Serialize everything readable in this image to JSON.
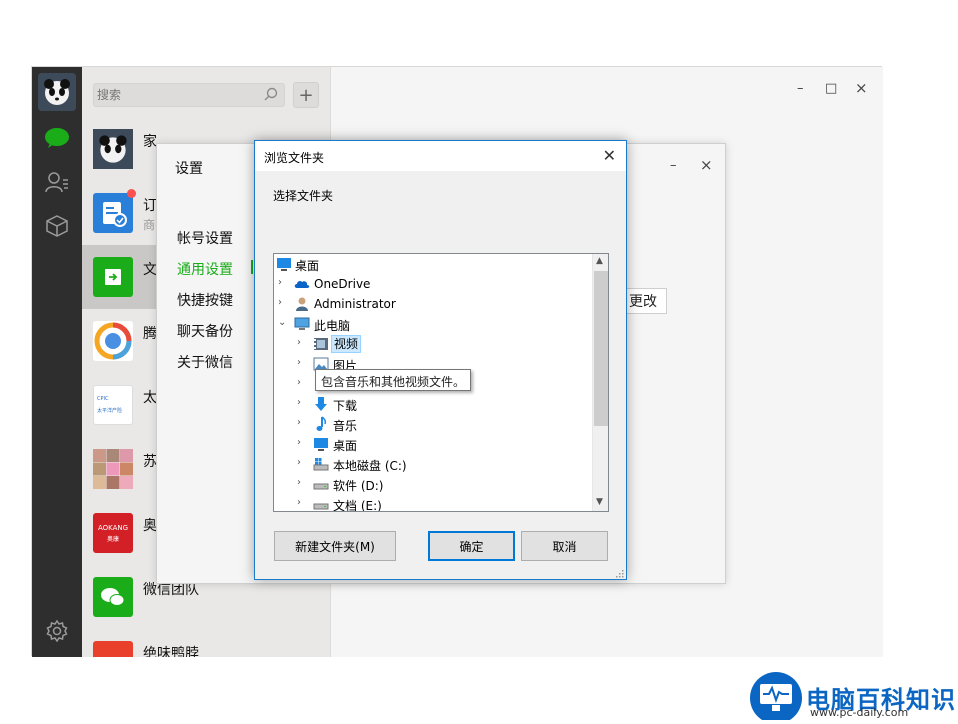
{
  "wechat": {
    "search_placeholder": "搜索",
    "add_label": "+",
    "chats": [
      {
        "name": "家",
        "sub": ""
      },
      {
        "name": "订",
        "sub": "商"
      },
      {
        "name": "文",
        "sub": ""
      },
      {
        "name": "腾",
        "sub": ""
      },
      {
        "name": "太",
        "sub": ""
      },
      {
        "name": "苏",
        "sub": ""
      },
      {
        "name": "奥",
        "sub": ""
      },
      {
        "name": "微信团队",
        "sub": ""
      },
      {
        "name": "绝味鸭脖",
        "sub": ""
      }
    ],
    "avatar_texts": {
      "tai": "太平洋产险",
      "aokang": "AOKANG",
      "aokang_cn": "奥康"
    },
    "window_controls": {
      "min": "–",
      "max": "□",
      "close": "×"
    }
  },
  "settings": {
    "title": "设置",
    "menu": [
      "帐号设置",
      "通用设置",
      "快捷按键",
      "聊天备份",
      "关于微信"
    ],
    "active_index": 1,
    "change_button": "更改",
    "controls": {
      "min": "–",
      "close": "×"
    }
  },
  "dialog": {
    "title": "浏览文件夹",
    "close": "✕",
    "prompt": "选择文件夹",
    "tree": [
      {
        "label": "桌面",
        "level": 0,
        "chevron": "",
        "icon": "desktop-icon"
      },
      {
        "label": "OneDrive",
        "level": 1,
        "chevron": "›",
        "icon": "onedrive-icon"
      },
      {
        "label": "Administrator",
        "level": 1,
        "chevron": "›",
        "icon": "user-icon"
      },
      {
        "label": "此电脑",
        "level": 1,
        "chevron": "⌄",
        "icon": "computer-icon"
      },
      {
        "label": "视频",
        "level": 2,
        "chevron": "›",
        "icon": "video-icon",
        "selected": true
      },
      {
        "label": "图片",
        "level": 2,
        "chevron": "›",
        "icon": "pictures-icon"
      },
      {
        "label": "",
        "level": 2,
        "chevron": "›",
        "icon": "documents-icon"
      },
      {
        "label": "下载",
        "level": 2,
        "chevron": "›",
        "icon": "download-icon"
      },
      {
        "label": "音乐",
        "level": 2,
        "chevron": "›",
        "icon": "music-icon"
      },
      {
        "label": "桌面",
        "level": 2,
        "chevron": "›",
        "icon": "desktop-icon"
      },
      {
        "label": "本地磁盘 (C:)",
        "level": 2,
        "chevron": "›",
        "icon": "drive-c-icon"
      },
      {
        "label": "软件 (D:)",
        "level": 2,
        "chevron": "›",
        "icon": "drive-icon"
      },
      {
        "label": "文档 (E:)",
        "level": 2,
        "chevron": "›",
        "icon": "drive-icon"
      }
    ],
    "tooltip": "包含音乐和其他视频文件。",
    "buttons": {
      "new_folder": "新建文件夹(M)",
      "ok": "确定",
      "cancel": "取消"
    }
  },
  "watermark": {
    "text": "电脑百科知识",
    "url": "www.pc-daily.com"
  },
  "colors": {
    "accent_green": "#1aad19",
    "dialog_border": "#1979ca",
    "rail": "#2e2e2e"
  }
}
